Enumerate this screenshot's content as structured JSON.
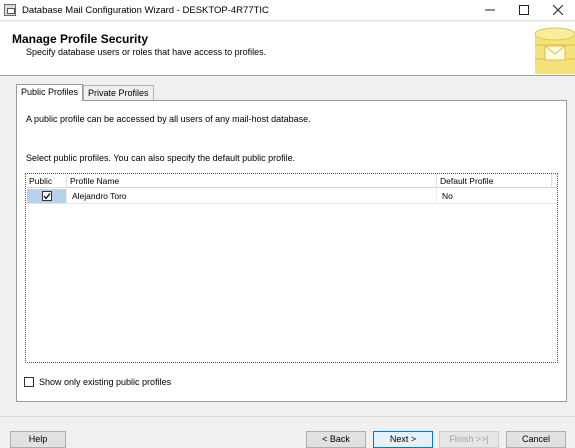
{
  "window": {
    "title": "Database Mail Configuration Wizard - DESKTOP-4R77TIC"
  },
  "header": {
    "title": "Manage Profile Security",
    "subtitle": "Specify database users or roles that have access to profiles."
  },
  "tabs": [
    {
      "label": "Public Profiles",
      "active": true
    },
    {
      "label": "Private Profiles",
      "active": false
    }
  ],
  "panel": {
    "description": "A public profile can be accessed by all users of any mail-host database.",
    "instruction": "Select public profiles. You can also specify the default public profile."
  },
  "grid": {
    "columns": [
      "Public",
      "Profile Name",
      "Default Profile"
    ],
    "rows": [
      {
        "public": true,
        "profile_name": "Alejandro Toro",
        "default_profile": "No"
      }
    ]
  },
  "options": {
    "show_existing_label": "Show only existing public profiles",
    "show_existing_checked": false
  },
  "buttons": {
    "help": "Help",
    "back": "< Back",
    "next": "Next >",
    "finish": "Finish >>|",
    "cancel": "Cancel"
  },
  "colors": {
    "accent": "#0078d7",
    "selection": "#b9d1ea"
  }
}
